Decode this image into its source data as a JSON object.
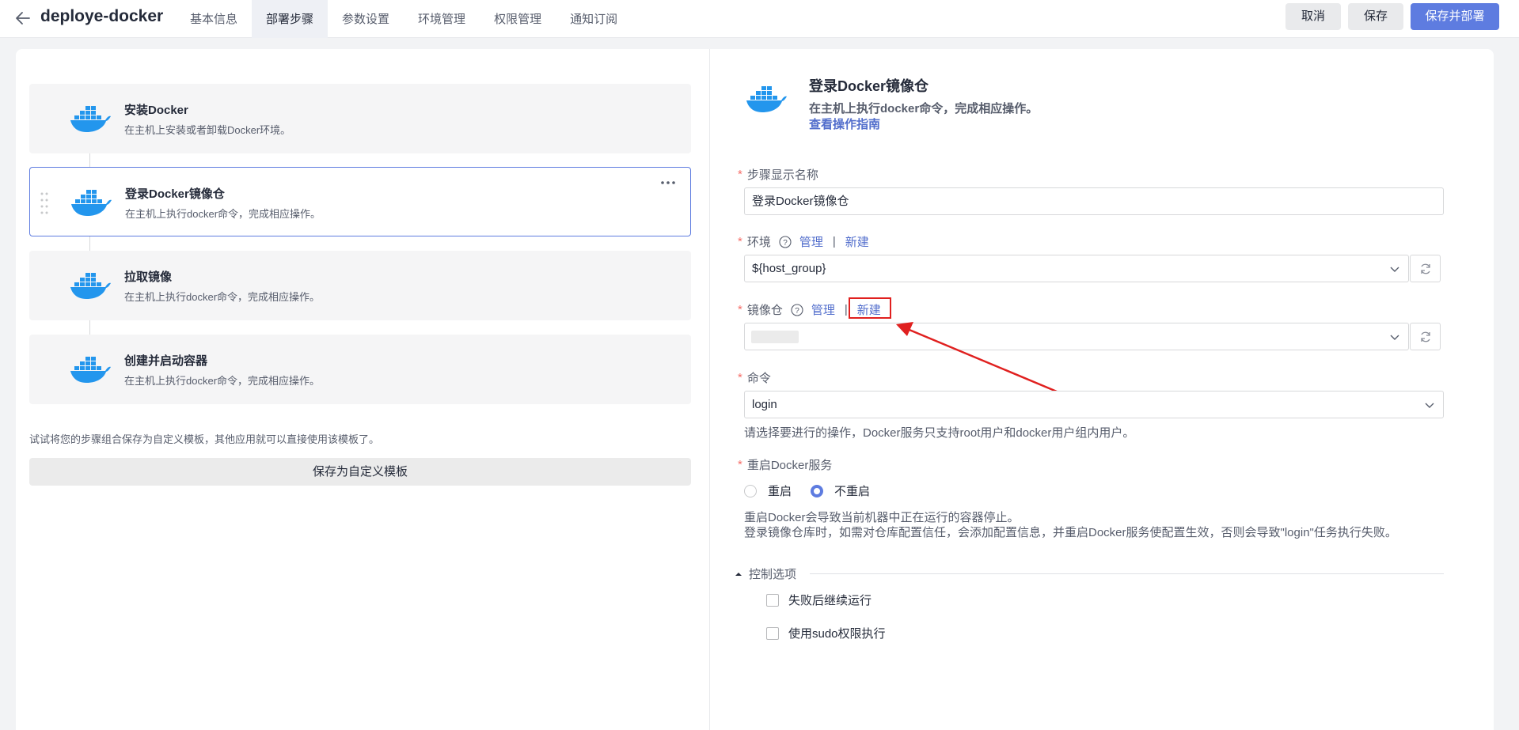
{
  "header": {
    "title": "deploye-docker",
    "tabs": [
      {
        "label": "基本信息",
        "active": false
      },
      {
        "label": "部署步骤",
        "active": true
      },
      {
        "label": "参数设置",
        "active": false
      },
      {
        "label": "环境管理",
        "active": false
      },
      {
        "label": "权限管理",
        "active": false
      },
      {
        "label": "通知订阅",
        "active": false
      }
    ],
    "cancel_label": "取消",
    "save_label": "保存",
    "save_deploy_label": "保存并部署"
  },
  "steps": [
    {
      "title": "安装Docker",
      "desc": "在主机上安装或者卸载Docker环境。",
      "active": false
    },
    {
      "title": "登录Docker镜像仓",
      "desc": "在主机上执行docker命令，完成相应操作。",
      "active": true
    },
    {
      "title": "拉取镜像",
      "desc": "在主机上执行docker命令，完成相应操作。",
      "active": false
    },
    {
      "title": "创建并启动容器",
      "desc": "在主机上执行docker命令，完成相应操作。",
      "active": false
    }
  ],
  "template": {
    "tip": "试试将您的步骤组合保存为自定义模板，其他应用就可以直接使用该模板了。",
    "button_label": "保存为自定义模板"
  },
  "detail": {
    "title": "登录Docker镜像仓",
    "desc": "在主机上执行docker命令，完成相应操作。",
    "guide_link": "查看操作指南"
  },
  "form": {
    "step_name": {
      "label": "步骤显示名称",
      "value": "登录Docker镜像仓"
    },
    "environment": {
      "label": "环境",
      "manage": "管理",
      "new": "新建",
      "value": "${host_group}"
    },
    "registry": {
      "label": "镜像仓",
      "manage": "管理",
      "new": "新建",
      "value": ""
    },
    "command": {
      "label": "命令",
      "value": "login",
      "hint": "请选择要进行的操作，Docker服务只支持root用户和docker用户组内用户。"
    },
    "restart": {
      "label": "重启Docker服务",
      "options": [
        {
          "label": "重启",
          "checked": false
        },
        {
          "label": "不重启",
          "checked": true
        }
      ],
      "hint1": "重启Docker会导致当前机器中正在运行的容器停止。",
      "hint2": "登录镜像仓库时，如需对仓库配置信任，会添加配置信息，并重启Docker服务使配置生效，否则会导致\"login\"任务执行失败。"
    },
    "control": {
      "title": "控制选项",
      "options": [
        {
          "label": "失败后继续运行",
          "checked": false
        },
        {
          "label": "使用sudo权限执行",
          "checked": false
        }
      ]
    },
    "separator": "|"
  },
  "colors": {
    "primary": "#5e7ce0",
    "link": "#526ecc",
    "required": "#f66f6a",
    "annotation": "#e0201f",
    "docker_blue": "#2396ed"
  }
}
